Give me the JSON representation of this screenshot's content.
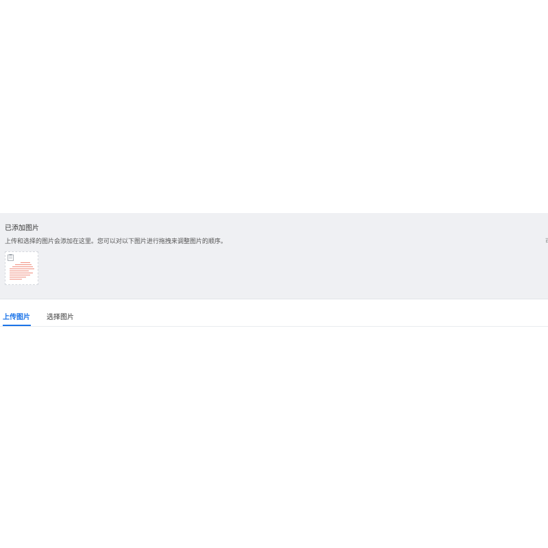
{
  "added_images": {
    "title": "已添加图片",
    "description": "上传和选择的图片会添加在这里。您可以对以下图片进行拖拽来调整图片的顺序。",
    "edge_text": "可",
    "thumbnail_icon": "document-icon",
    "thumbnail_line_color": "#f08a7a"
  },
  "tabs": {
    "items": [
      {
        "label": "上传图片",
        "active": true
      },
      {
        "label": "选择图片",
        "active": false
      }
    ],
    "active_color": "#1a73e8"
  }
}
